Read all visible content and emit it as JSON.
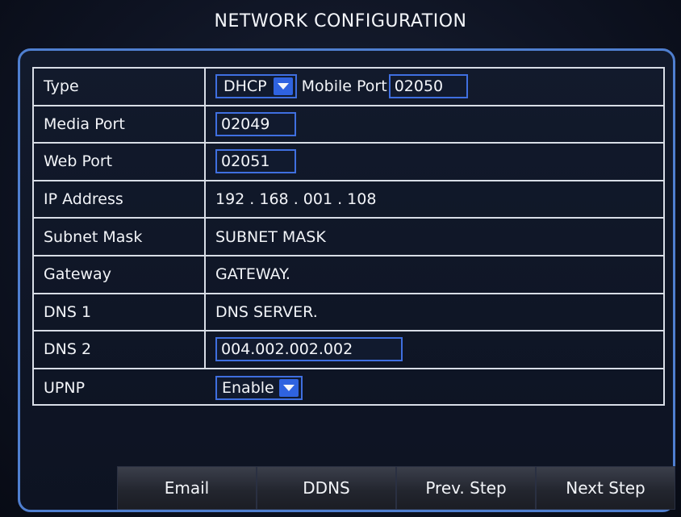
{
  "title": "NETWORK CONFIGURATION",
  "rows": {
    "type": {
      "label": "Type",
      "select_value": "DHCP",
      "mobile_port_label": "Mobile Port",
      "mobile_port_value": "02050"
    },
    "media_port": {
      "label": "Media Port",
      "value": "02049"
    },
    "web_port": {
      "label": "Web Port",
      "value": "02051"
    },
    "ip_address": {
      "label": "IP Address",
      "value": "192 . 168 . 001 . 108"
    },
    "subnet_mask": {
      "label": "Subnet Mask",
      "value": "SUBNET MASK"
    },
    "gateway": {
      "label": "Gateway",
      "value": "GATEWAY."
    },
    "dns1": {
      "label": "DNS 1",
      "value": "DNS SERVER."
    },
    "dns2": {
      "label": "DNS 2",
      "value": "004.002.002.002"
    },
    "upnp": {
      "label": "UPNP",
      "select_value": "Enable"
    }
  },
  "buttons": {
    "email": "Email",
    "ddns": "DDNS",
    "prev": "Prev. Step",
    "next": "Next Step"
  },
  "colors": {
    "accent": "#3f6fe0",
    "panel_border": "#4f7fd0",
    "grid_lines": "#d8dde6"
  }
}
